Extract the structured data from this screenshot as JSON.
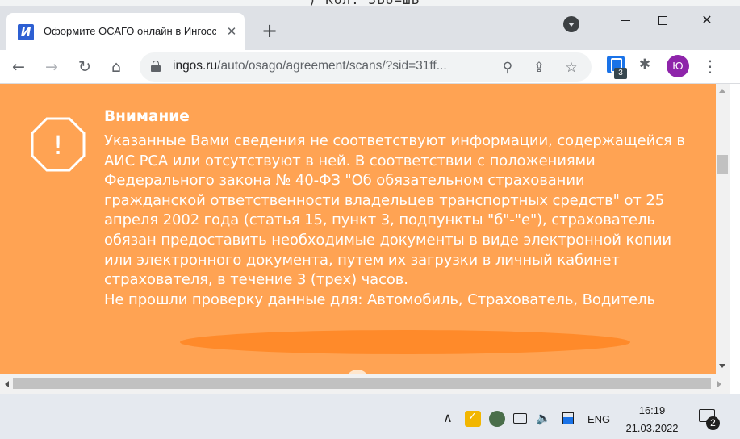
{
  "background_window": {
    "text": ") Кол: ЗЬU=ШЬ"
  },
  "browser": {
    "tab": {
      "favicon_letter": "И",
      "title": "Оформите ОСАГО онлайн в Ингосстрах",
      "close_glyph": "✕"
    },
    "new_tab_glyph": "+",
    "window_controls": {
      "close_glyph": "✕"
    },
    "nav": {
      "back_glyph": "←",
      "forward_glyph": "→",
      "reload_glyph": "↻",
      "home_glyph": "⌂"
    },
    "address": {
      "host": "ingos.ru",
      "path": "/auto/osago/agreement/scans/?sid=31ff..."
    },
    "omnibox_icons": {
      "zoom_glyph": "⚲",
      "share_glyph": "⇪",
      "star_glyph": "☆"
    },
    "extension_badge": "3",
    "profile_initial": "Ю",
    "menu_glyph": "⋮"
  },
  "notice": {
    "title": "Внимание",
    "body": "Указанные Вами сведения не соответствуют информации, содержащейся в АИС РСА или отсутствуют в ней. В соответствии с положениями Федерального закона № 40-ФЗ \"Об обязательном страховании гражданской ответственности владельцев транспортных средств\" от 25 апреля 2002 года (статья 15, пункт 3, подпункты \"б\"-\"е\"), страхователь обязан предоставить необходимые документы в виде электронной копии или электронного документа, путем их загрузки в личный кабинет страхователя, в течение 3 (трех) часов.",
    "check_failed": "Не прошли проверку данные для: Автомобиль, Страхователь, Водитель",
    "icon_glyph": "!",
    "background_color": "#ffa353",
    "redaction_color": "#ff8a2a"
  },
  "taskbar": {
    "chevron_glyph": "∧",
    "volume_glyph": "🔈",
    "language": "ENG",
    "time": "16:19",
    "date": "21.03.2022",
    "notifications_count": "2"
  }
}
